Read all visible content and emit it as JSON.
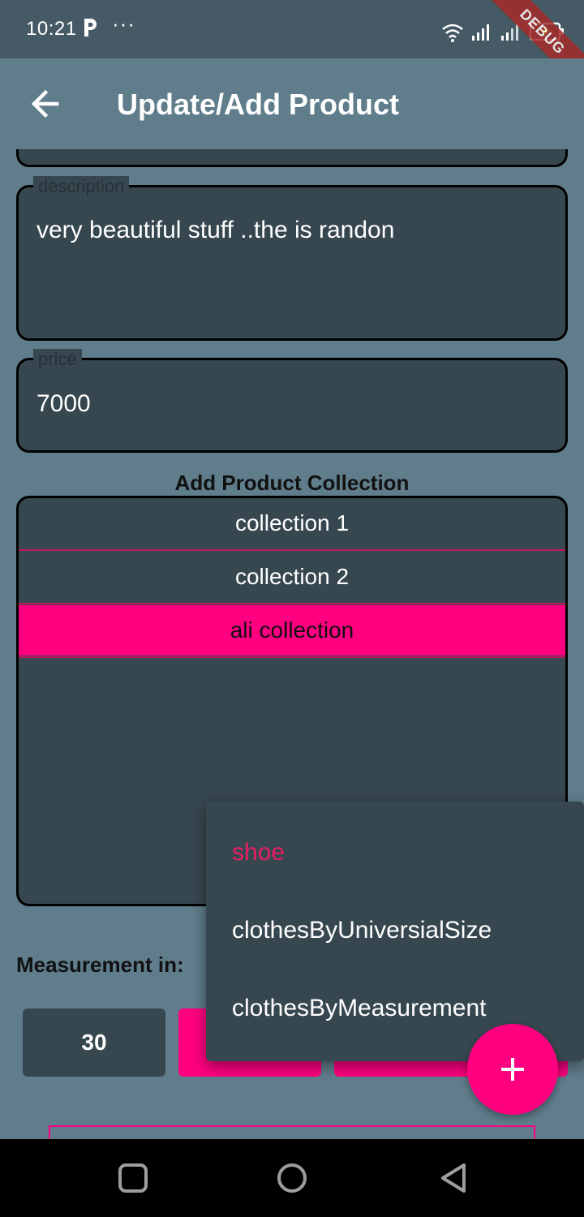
{
  "status_bar": {
    "time": "10:21",
    "debug_label": "DEBUG"
  },
  "app_bar": {
    "title": "Update/Add Product",
    "back_icon": "arrow-back-icon"
  },
  "form": {
    "description": {
      "label": "description",
      "value": "very beautiful stuff ..the is randon"
    },
    "price": {
      "label": "price",
      "value": "7000"
    }
  },
  "collections": {
    "title": "Add Product Collection",
    "items": [
      {
        "label": "collection 1",
        "selected": false
      },
      {
        "label": "collection 2",
        "selected": false
      },
      {
        "label": "ali collection",
        "selected": true
      }
    ]
  },
  "measurement": {
    "label": "Measurement in:",
    "sizes": [
      {
        "label": "30",
        "color": "#37474f"
      },
      {
        "label": "",
        "color": "#ff0080"
      },
      {
        "label": "",
        "color": "#ff0080"
      }
    ]
  },
  "dropdown": {
    "options": [
      {
        "label": "shoe",
        "selected": true
      },
      {
        "label": "clothesByUniversialSize",
        "selected": false
      },
      {
        "label": "clothesByMeasurement",
        "selected": false
      }
    ]
  },
  "fab": {
    "icon": "plus-icon"
  },
  "colors": {
    "background": "#607d8b",
    "field": "#37474f",
    "accent": "#ff0080",
    "status_bar": "#455a64"
  },
  "nav": {
    "icons": [
      "recent-apps-icon",
      "home-icon",
      "back-icon"
    ]
  }
}
